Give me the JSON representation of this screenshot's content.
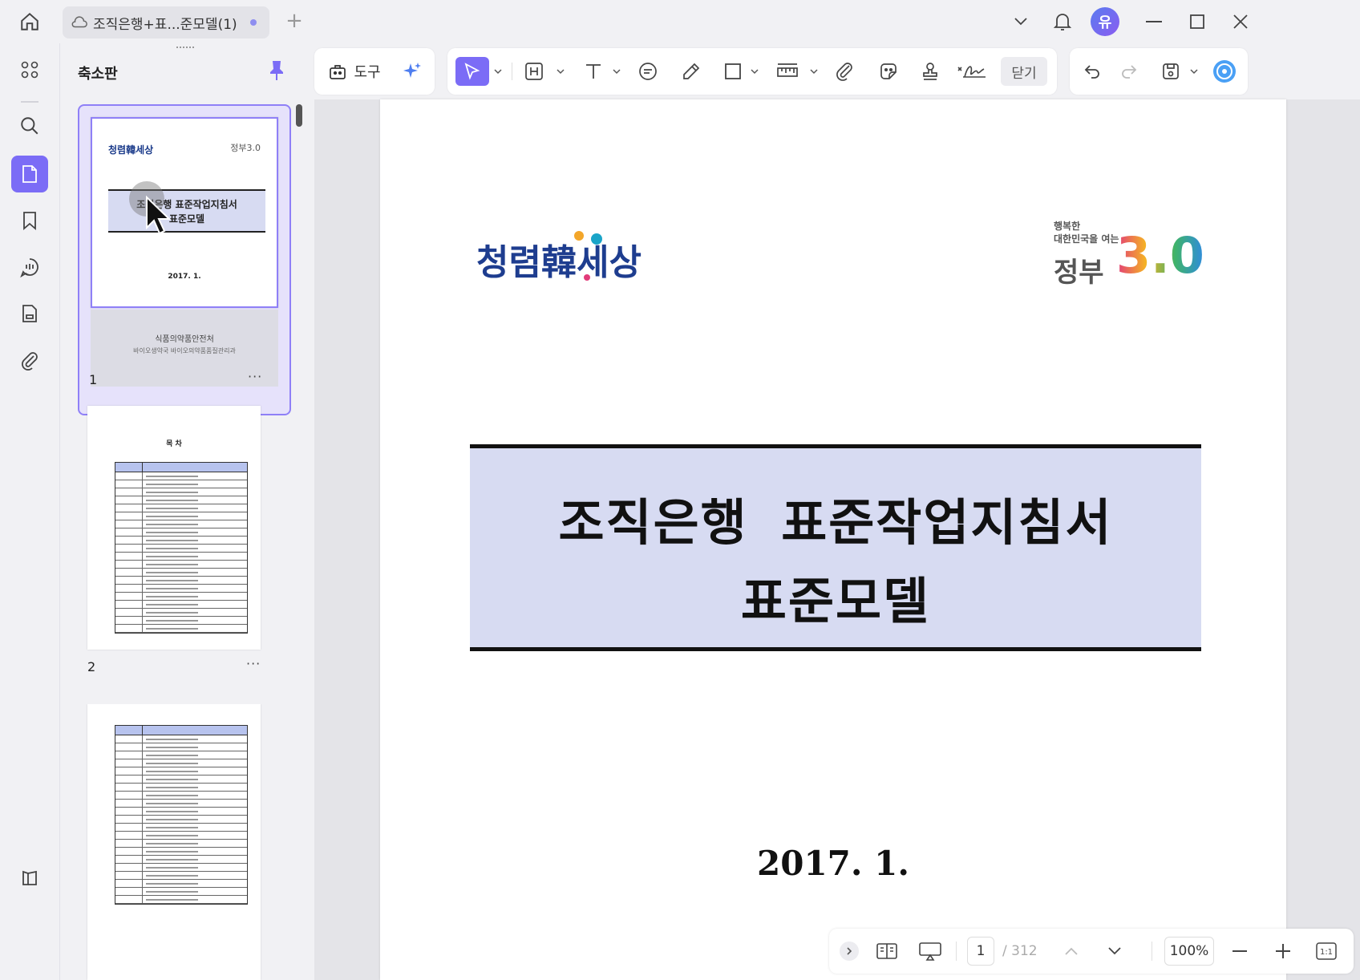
{
  "tab": {
    "title": "조직은행+표...준모델(1)",
    "new_tab": "+"
  },
  "user": {
    "avatar_initial": "유"
  },
  "panel": {
    "title": "축소판"
  },
  "thumbnails": [
    {
      "number": "1",
      "more": "···",
      "logo_text": "청렴韓세상",
      "gov_text": "정부3.0",
      "title_line1": "조직은행 표준작업지침서",
      "title_line2": "표준모델",
      "date": "2017. 1.",
      "ministry": "식품의약품안전처",
      "dept": "바이오생약국 바이오의약품품질관리과"
    },
    {
      "number": "2",
      "more": "···",
      "toc_title": "목 차"
    },
    {
      "number": "3"
    }
  ],
  "toolbar": {
    "tools_label": "도구",
    "close_label": "닫기"
  },
  "page": {
    "logo_text": "청렴韓세상",
    "gov_small_line1": "행복한",
    "gov_small_line2": "대한민국을 여는",
    "gov_big": "정부",
    "gov_num": "3.0",
    "title_line1": "조직은행 표준작업지침서",
    "title_line2": "표준모델",
    "date": "2017. 1."
  },
  "navbar": {
    "current_page": "1",
    "total_pages": "/ 312",
    "zoom": "100%"
  },
  "colors": {
    "accent": "#7b6cf6",
    "banner": "#d7dbf2"
  }
}
